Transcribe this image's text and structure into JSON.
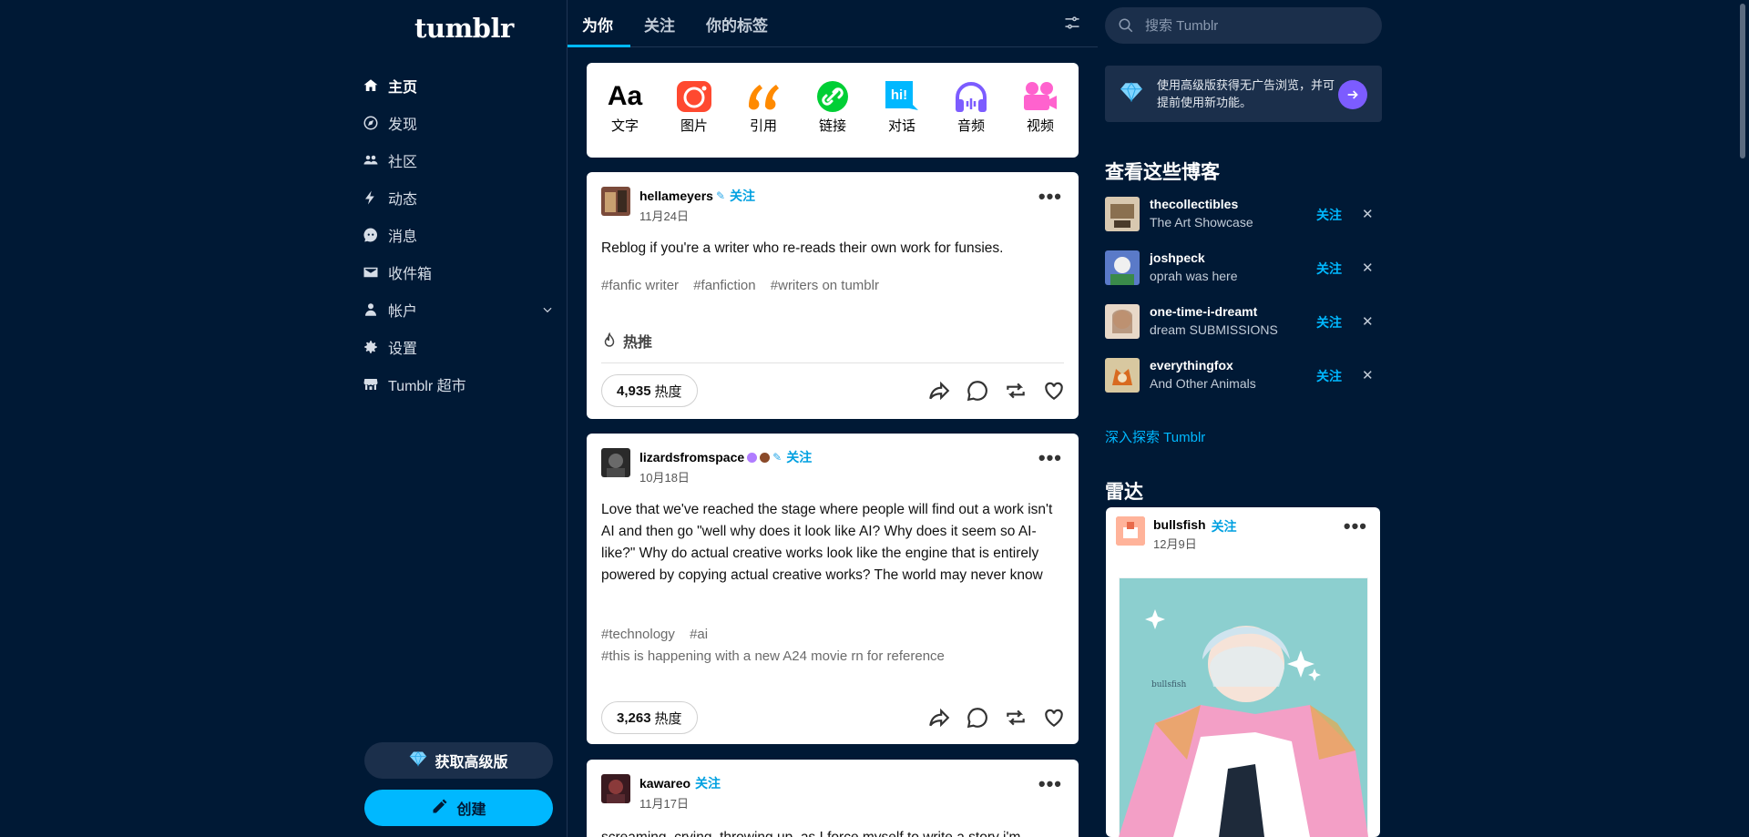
{
  "app": {
    "logo": "tumblr"
  },
  "sidebar": {
    "items": [
      {
        "label": "主页",
        "icon": "home-icon",
        "active": true
      },
      {
        "label": "发现",
        "icon": "compass-icon"
      },
      {
        "label": "社区",
        "icon": "community-icon"
      },
      {
        "label": "动态",
        "icon": "lightning-icon"
      },
      {
        "label": "消息",
        "icon": "message-icon"
      },
      {
        "label": "收件箱",
        "icon": "inbox-icon"
      },
      {
        "label": "帐户",
        "icon": "user-icon"
      },
      {
        "label": "设置",
        "icon": "gear-icon"
      },
      {
        "label": "Tumblr 超市",
        "icon": "store-icon"
      }
    ],
    "premium_label": "获取高级版",
    "create_label": "创建"
  },
  "feed": {
    "tabs": [
      "为你",
      "关注",
      "你的标签"
    ],
    "composer": [
      {
        "label": "文字",
        "icon": "text-icon",
        "glyph": "Aa"
      },
      {
        "label": "图片",
        "icon": "camera-icon"
      },
      {
        "label": "引用",
        "icon": "quote-icon"
      },
      {
        "label": "链接",
        "icon": "link-icon"
      },
      {
        "label": "对话",
        "icon": "chat-icon",
        "glyph": "hi!"
      },
      {
        "label": "音频",
        "icon": "headphones-icon"
      },
      {
        "label": "视频",
        "icon": "video-icon"
      }
    ],
    "posts": [
      {
        "author": "hellameyers",
        "follow": "关注",
        "date": "11月24日",
        "body": "Reblog if you're a writer who re-reads their own work for funsies.",
        "tags": [
          "#fanfic writer",
          "#fanfiction",
          "#writers on tumblr"
        ],
        "hot_label": "热推",
        "notes_count": "4,935",
        "notes_label": "热度"
      },
      {
        "author": "lizardsfromspace",
        "follow": "关注",
        "date": "10月18日",
        "body": "Love that we've reached the stage where people will find out a work isn't AI and then go \"well why does it look like AI? Why does it seem so AI-like?\" Why do actual creative works look like the engine that is entirely powered by copying actual creative works? The world may never know",
        "tags": [
          "#technology",
          "#ai"
        ],
        "tags_line2": "#this is happening with a new A24 movie rn for reference",
        "notes_count": "3,263",
        "notes_label": "热度"
      },
      {
        "author": "kawareo",
        "follow": "关注",
        "date": "11月17日",
        "body": "screaming, crying, throwing up, as I force myself to write a story i'm"
      }
    ]
  },
  "right": {
    "search_placeholder": "搜索 Tumblr",
    "promo_text": "使用高级版获得无广告浏览，并可提前使用新功能。",
    "blogs_title": "查看这些博客",
    "blogs": [
      {
        "name": "thecollectibles",
        "sub": "The Art Showcase",
        "follow": "关注"
      },
      {
        "name": "joshpeck",
        "sub": "oprah was here",
        "follow": "关注"
      },
      {
        "name": "one-time-i-dreamt",
        "sub": "dream SUBMISSIONS",
        "follow": "关注"
      },
      {
        "name": "everythingfox",
        "sub": "And Other Animals",
        "follow": "关注"
      }
    ],
    "explore_label": "深入探索 Tumblr",
    "radar_title": "雷达",
    "radar_post": {
      "author": "bullsfish",
      "follow": "关注",
      "date": "12月9日"
    }
  },
  "colors": {
    "background": "#001935",
    "accent": "#00b8ff",
    "premium": "#7c5cff"
  }
}
